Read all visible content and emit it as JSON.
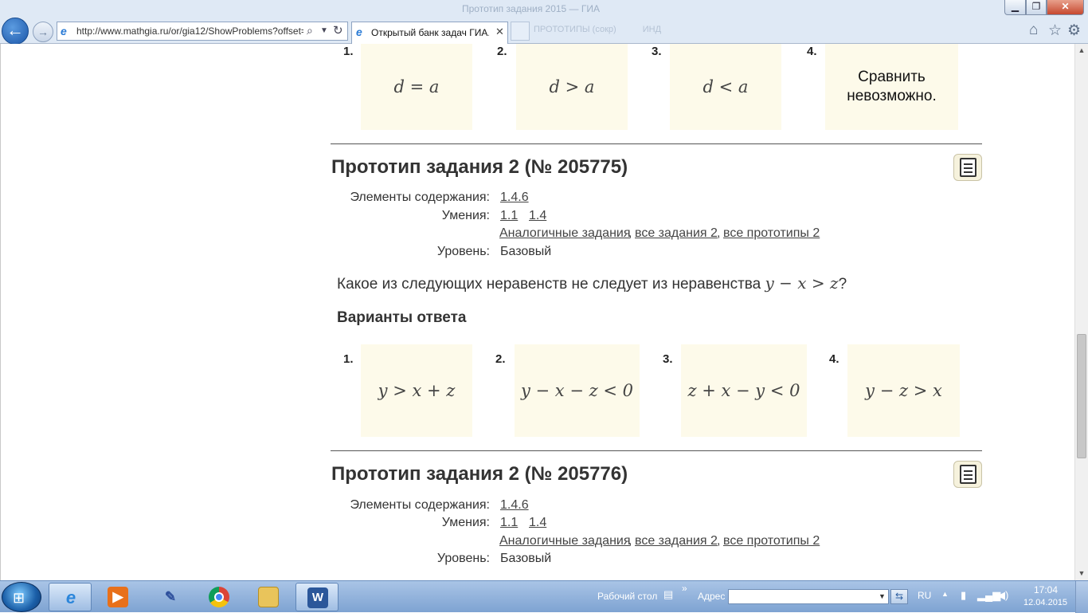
{
  "browser": {
    "title_ghost": "Прототип задания 2015 — ГИА",
    "url": "http://www.mathgia.ru/or/gia12/ShowProblems?offset=",
    "tab_title": "Открытый банк задач ГИА...",
    "ghost_menu": "ПРОТОТИПЫ (сокр)",
    "ghost_menu2": "ИНД"
  },
  "page": {
    "top_options": [
      {
        "num": "1.",
        "text": "d = a"
      },
      {
        "num": "2.",
        "text": "d > a"
      },
      {
        "num": "3.",
        "text": "d < a"
      },
      {
        "num": "4.",
        "line1": "Сравнить",
        "line2": "невозможно."
      }
    ],
    "prototype1": {
      "title": "Прототип задания 2 (№ 205775)",
      "content_label": "Элементы содержания:",
      "content_link": "1.4.6",
      "skills_label": "Умения:",
      "skill1": "1.1",
      "skill2": "1.4",
      "similar_link": "Аналогичные задания",
      "all_tasks_link": "все задания 2",
      "all_protos_link": "все прототипы 2",
      "comma": ",",
      "level_label": "Уровень:",
      "level_value": "Базовый",
      "question_prefix": "Какое из следующих неравенств не следует из неравенства",
      "question_math": "y − x > z",
      "question_suffix": "?",
      "answers_title": "Варианты ответа",
      "options": [
        {
          "num": "1.",
          "text": "y > x + z"
        },
        {
          "num": "2.",
          "text": "y − x − z < 0"
        },
        {
          "num": "3.",
          "text": "z + x − y < 0"
        },
        {
          "num": "4.",
          "text": "y − z > x"
        }
      ]
    },
    "prototype2": {
      "title": "Прототип задания 2 (№ 205776)",
      "content_label": "Элементы содержания:",
      "content_link": "1.4.6",
      "skills_label": "Умения:",
      "skill1": "1.1",
      "skill2": "1.4",
      "similar_link": "Аналогичные задания",
      "all_tasks_link": "все задания 2",
      "all_protos_link": "все прототипы 2",
      "comma": ",",
      "level_label": "Уровень:",
      "level_value": "Базовый"
    }
  },
  "taskbar": {
    "desktop_label": "Рабочий стол",
    "more": "»",
    "address_label": "Адрес",
    "lang": "RU",
    "time": "17:04",
    "date": "12.04.2015"
  }
}
